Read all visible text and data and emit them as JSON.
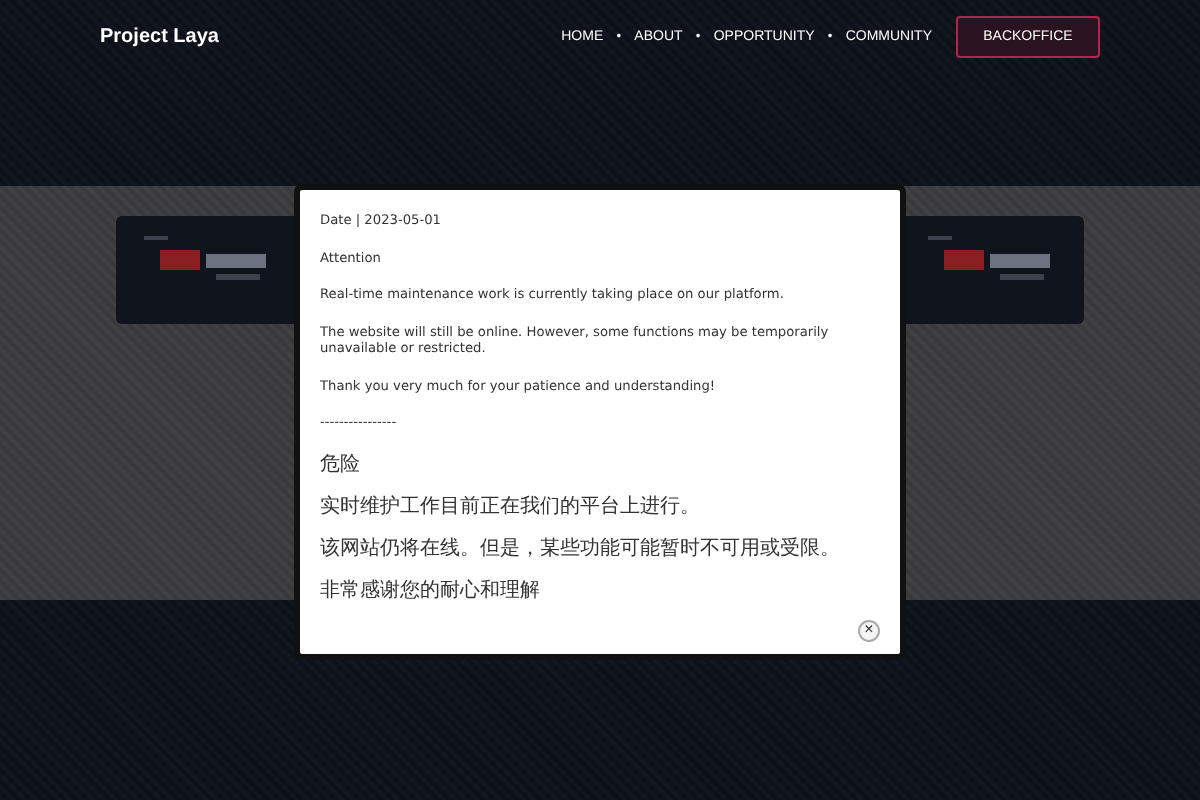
{
  "header": {
    "brand": "Project Laya",
    "nav": [
      {
        "label": "HOME"
      },
      {
        "label": "ABOUT"
      },
      {
        "label": "OPPORTUNITY"
      },
      {
        "label": "COMMUNITY"
      }
    ],
    "nav_separator": "•",
    "action": "BACKOFFICE"
  },
  "modal": {
    "date": "Date | 2023-05-01",
    "paragraphs": [
      "Attention",
      "Real-time maintenance work is currently taking place on our platform.",
      "The website will still be online. However, some functions may be temporarily unavailable or restricted.",
      "Thank you very much for your patience and understanding!",
      "----------------",
      "危险",
      "实时维护工作目前正在我们的平台上进行。",
      "该网站仍将在线。但是，某些功能可能暂时不可用或受限。",
      "非常感谢您的耐心和理解"
    ],
    "close": "×"
  }
}
